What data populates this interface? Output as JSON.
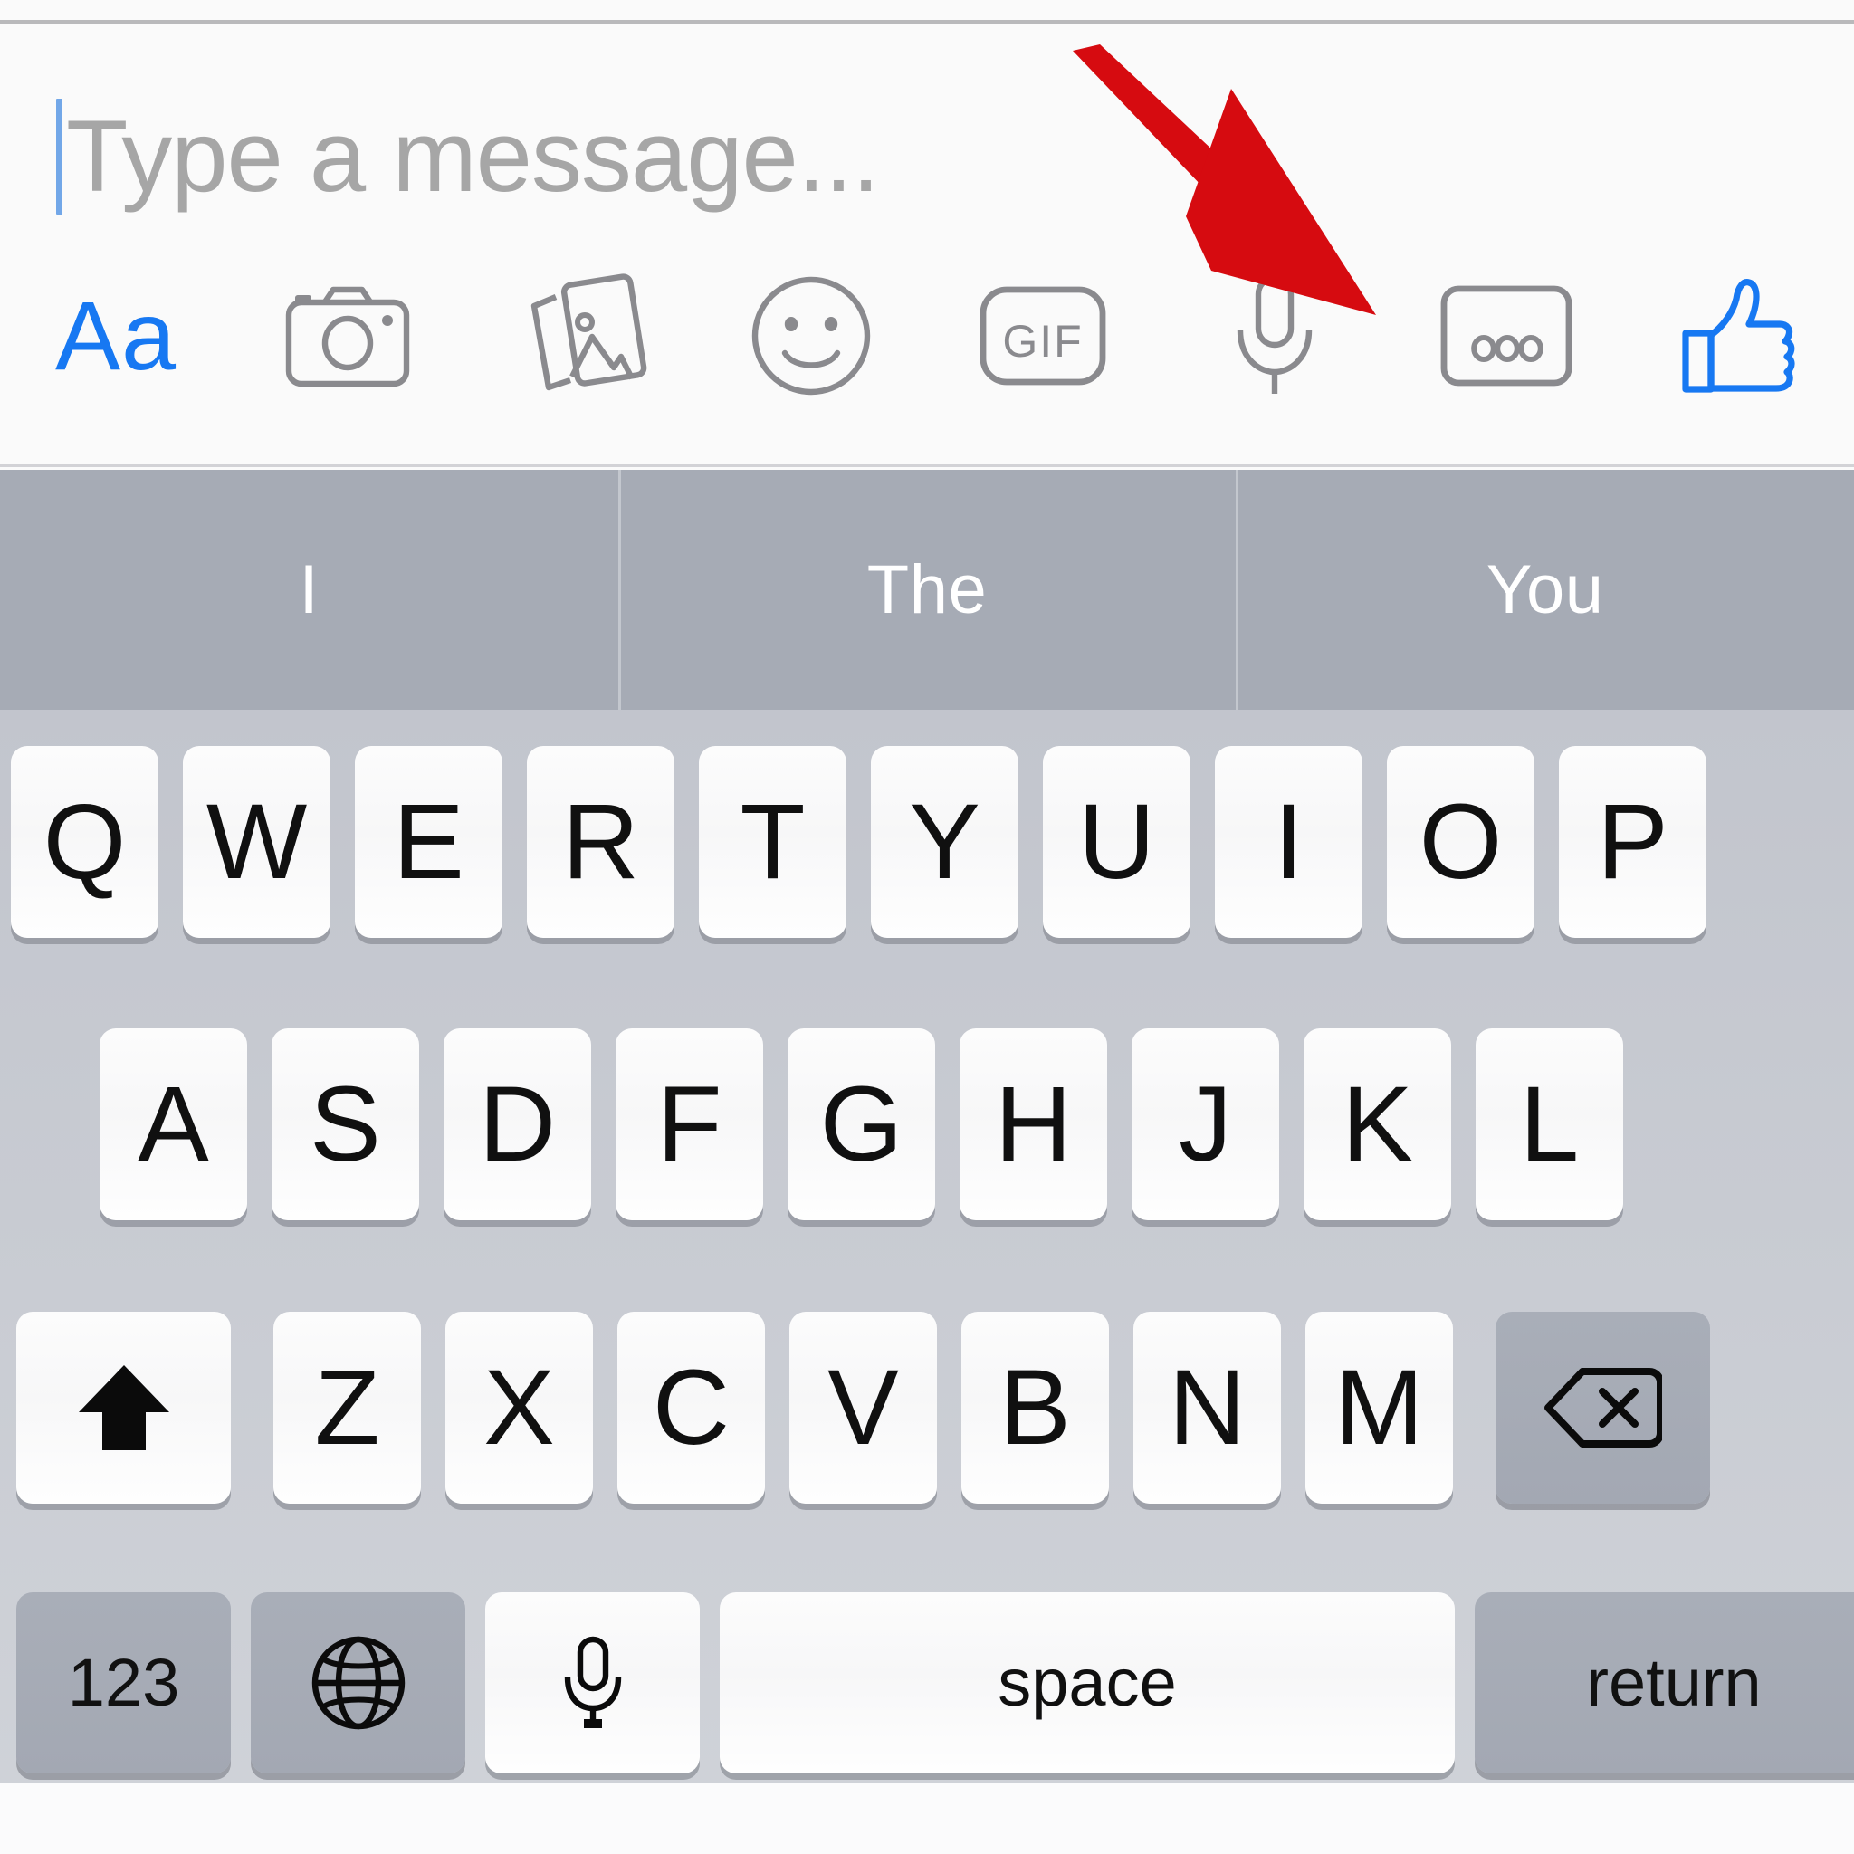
{
  "app": {
    "name": "Messenger Chat Composer",
    "platform": "iOS"
  },
  "composer": {
    "input": {
      "value": "",
      "placeholder": "Type a message...",
      "caret_visible": true,
      "caret_color": "#72a7e8"
    },
    "toolbar": {
      "items": [
        {
          "name": "text-format",
          "icon": "aa-icon",
          "label": "Aa",
          "color": "#1778f2",
          "active": true
        },
        {
          "name": "camera",
          "icon": "camera-icon",
          "label": "",
          "color": "#8a8a8e",
          "active": false
        },
        {
          "name": "photo-gallery",
          "icon": "photos-icon",
          "label": "",
          "color": "#8a8a8e",
          "active": false
        },
        {
          "name": "stickers",
          "icon": "smiley-icon",
          "label": "",
          "color": "#8a8a8e",
          "active": false
        },
        {
          "name": "gif",
          "icon": "gif-icon",
          "label": "GIF",
          "color": "#8a8a8e",
          "active": false
        },
        {
          "name": "voice-message",
          "icon": "microphone-icon",
          "label": "",
          "color": "#8a8a8e",
          "active": false
        },
        {
          "name": "more-options",
          "icon": "more-dots-icon",
          "label": "•••",
          "color": "#8a8a8e",
          "active": false
        },
        {
          "name": "like",
          "icon": "thumbs-up-icon",
          "label": "",
          "color": "#1778f2",
          "active": false
        }
      ]
    }
  },
  "annotation": {
    "type": "arrow",
    "color": "#d60b10",
    "points_to": "more-options"
  },
  "keyboard": {
    "suggestions": [
      "I",
      "The",
      "You"
    ],
    "rows": [
      [
        "Q",
        "W",
        "E",
        "R",
        "T",
        "Y",
        "U",
        "I",
        "O",
        "P"
      ],
      [
        "A",
        "S",
        "D",
        "F",
        "G",
        "H",
        "J",
        "K",
        "L"
      ],
      [
        "Z",
        "X",
        "C",
        "V",
        "B",
        "N",
        "M"
      ]
    ],
    "shift_key": {
      "name": "shift",
      "icon": "shift-arrow-icon",
      "label": ""
    },
    "delete_key": {
      "name": "delete",
      "icon": "backspace-icon",
      "label": ""
    },
    "bottom_row": {
      "numbers_key": "123",
      "globe_key": {
        "name": "globe",
        "icon": "globe-icon",
        "label": ""
      },
      "dictation_key": {
        "name": "dictation",
        "icon": "microphone-icon",
        "label": ""
      },
      "space_key": "space",
      "return_key": "return"
    },
    "colors": {
      "suggestion_bar_bg": "#a6abb5",
      "keyboard_bg": "#c8cbd2",
      "key_bg": "#fcfcfc",
      "modifier_key_bg": "#a9aeb8"
    }
  }
}
